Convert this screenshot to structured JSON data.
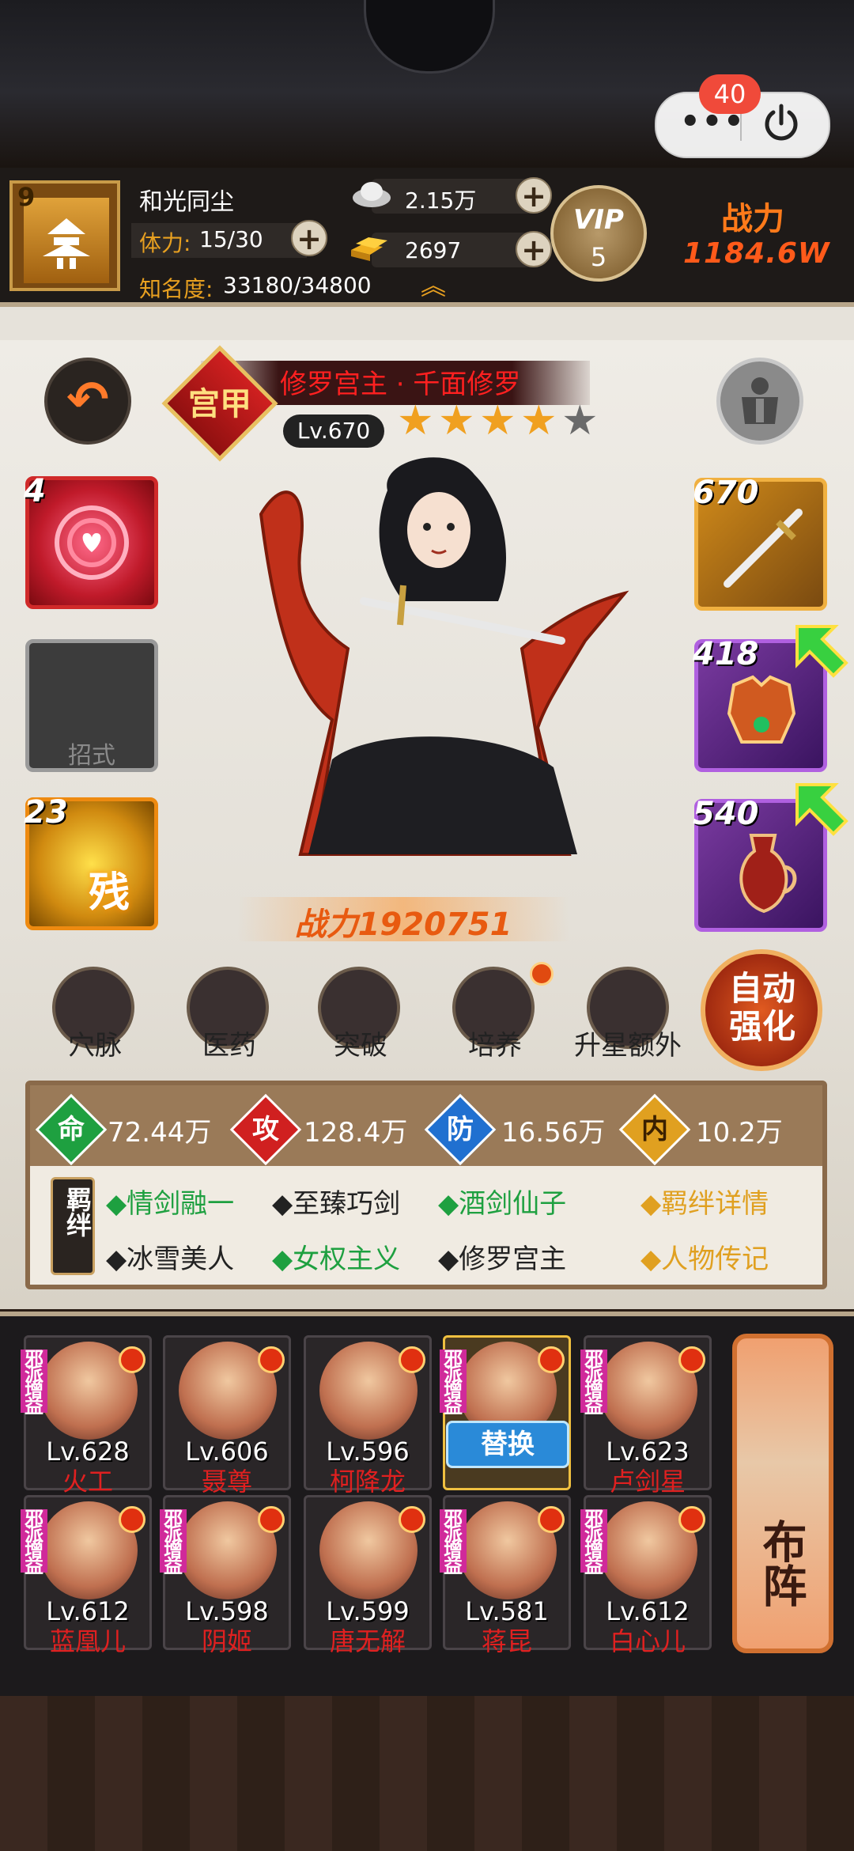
{
  "system": {
    "notification_count": "40"
  },
  "player": {
    "level": "9",
    "name": "和光同尘",
    "stamina_label": "体力:",
    "stamina": "15/30",
    "fame_label": "知名度:",
    "fame": "33180/34800",
    "silver": "2.15万",
    "gold": "2697",
    "vip_label": "VIP",
    "vip_level": "5",
    "power_label": "战力",
    "power_value": "1184.6W"
  },
  "hero": {
    "rank": "宫甲",
    "name": "修罗宫主 · 千面修罗",
    "level": "Lv.670",
    "stars_total": 5,
    "stars_filled": 4,
    "power": "战力1920751"
  },
  "skills": [
    {
      "level": "4",
      "kind": "heart-rose"
    },
    {
      "label": "招式"
    },
    {
      "level": "23",
      "glyph": "残"
    }
  ],
  "equipment": [
    {
      "level": "670",
      "kind": "sword",
      "upgradable": false
    },
    {
      "level": "418",
      "kind": "armor",
      "upgradable": true
    },
    {
      "level": "540",
      "kind": "teapot",
      "upgradable": true
    }
  ],
  "actions": [
    {
      "label": "穴脉"
    },
    {
      "label": "医药"
    },
    {
      "label": "突破"
    },
    {
      "label": "培养",
      "badge": true
    },
    {
      "label": "升星额外"
    }
  ],
  "auto_enhance": "自动强化",
  "stats": [
    {
      "label": "命",
      "value": "72.44万",
      "color": "#1ea040"
    },
    {
      "label": "攻",
      "value": "128.4万",
      "color": "#d02020"
    },
    {
      "label": "防",
      "value": "16.56万",
      "color": "#2070d0"
    },
    {
      "label": "内",
      "value": "10.2万",
      "color": "#e0a020"
    }
  ],
  "bonds": {
    "tag": "羁绊",
    "items": [
      {
        "text": "◆情剑融一",
        "active": true
      },
      {
        "text": "◆至臻巧剑",
        "active": false
      },
      {
        "text": "◆酒剑仙子",
        "active": true
      },
      {
        "text": "◆冰雪美人",
        "active": false
      },
      {
        "text": "◆女权主义",
        "active": true
      },
      {
        "text": "◆修罗宫主",
        "active": false
      }
    ],
    "links": [
      "◆羁绊详情",
      "◆人物传记"
    ]
  },
  "lineup": {
    "tag": "邪派增益",
    "swap_label": "替换",
    "formation_label": "布阵",
    "members": [
      {
        "level": "Lv.628",
        "name": "火工",
        "tagged": true
      },
      {
        "level": "Lv.606",
        "name": "聂尊",
        "tagged": false
      },
      {
        "level": "Lv.596",
        "name": "柯降龙",
        "tagged": false
      },
      {
        "level": "",
        "name": "",
        "tagged": true,
        "selected": true
      },
      {
        "level": "Lv.623",
        "name": "卢剑星",
        "tagged": true
      },
      {
        "level": "Lv.612",
        "name": "蓝凰儿",
        "tagged": true
      },
      {
        "level": "Lv.598",
        "name": "阴姬",
        "tagged": true
      },
      {
        "level": "Lv.599",
        "name": "唐无解",
        "tagged": false
      },
      {
        "level": "Lv.581",
        "name": "蒋昆",
        "tagged": true
      },
      {
        "level": "Lv.612",
        "name": "白心儿",
        "tagged": true
      }
    ]
  }
}
